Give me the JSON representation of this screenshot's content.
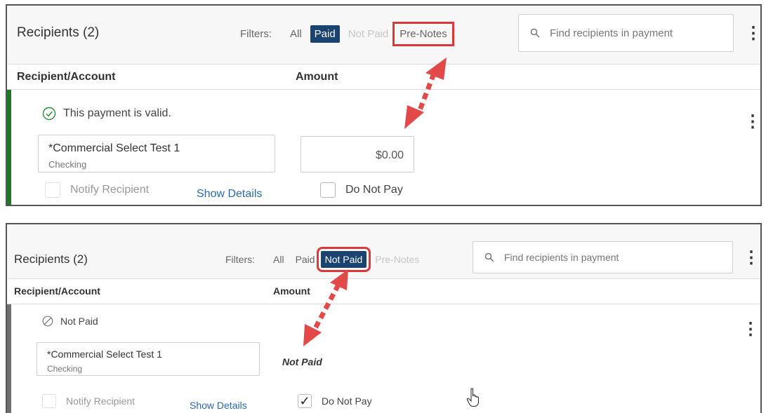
{
  "panels": [
    {
      "title": "Recipients (2)",
      "filters_label": "Filters:",
      "filters": [
        {
          "label": "All",
          "state": "normal"
        },
        {
          "label": "Paid",
          "state": "active"
        },
        {
          "label": "Not Paid",
          "state": "disabled"
        },
        {
          "label": "Pre-Notes",
          "state": "highlighted"
        }
      ],
      "search_placeholder": "Find recipients in payment",
      "columns": [
        "Recipient/Account",
        "Amount"
      ],
      "row": {
        "status_text": "This payment is valid.",
        "status_icon": "check-circle-icon",
        "account_name": "*Commercial Select Test 1",
        "account_type": "Checking",
        "amount": "$0.00",
        "notify_label": "Notify Recipient",
        "show_details_label": "Show Details",
        "do_not_pay_label": "Do Not Pay",
        "do_not_pay_checked": false,
        "accent_color": "#1e7a22"
      }
    },
    {
      "title": "Recipients (2)",
      "filters_label": "Filters:",
      "filters": [
        {
          "label": "All",
          "state": "normal"
        },
        {
          "label": "Paid",
          "state": "normal"
        },
        {
          "label": "Not Paid",
          "state": "active-highlighted"
        },
        {
          "label": "Pre-Notes",
          "state": "disabled"
        }
      ],
      "search_placeholder": "Find recipients in payment",
      "columns": [
        "Recipient/Account",
        "Amount"
      ],
      "row": {
        "status_text": "Not Paid",
        "status_icon": "ban-circle-icon",
        "account_name": "*Commercial Select Test 1",
        "account_type": "Checking",
        "amount": "Not Paid",
        "notify_label": "Notify Recipient",
        "show_details_label": "Show Details",
        "do_not_pay_label": "Do Not Pay",
        "do_not_pay_checked": true,
        "checkmark": "✓",
        "accent_color": "#707070"
      }
    }
  ],
  "colors": {
    "active_filter": "#1a4370",
    "highlight_box": "#d9393b",
    "arrow": "#e24a4a",
    "link": "#2e6aa7"
  },
  "annotation_arrow_icon": "double-headed-dotted-arrow-icon"
}
